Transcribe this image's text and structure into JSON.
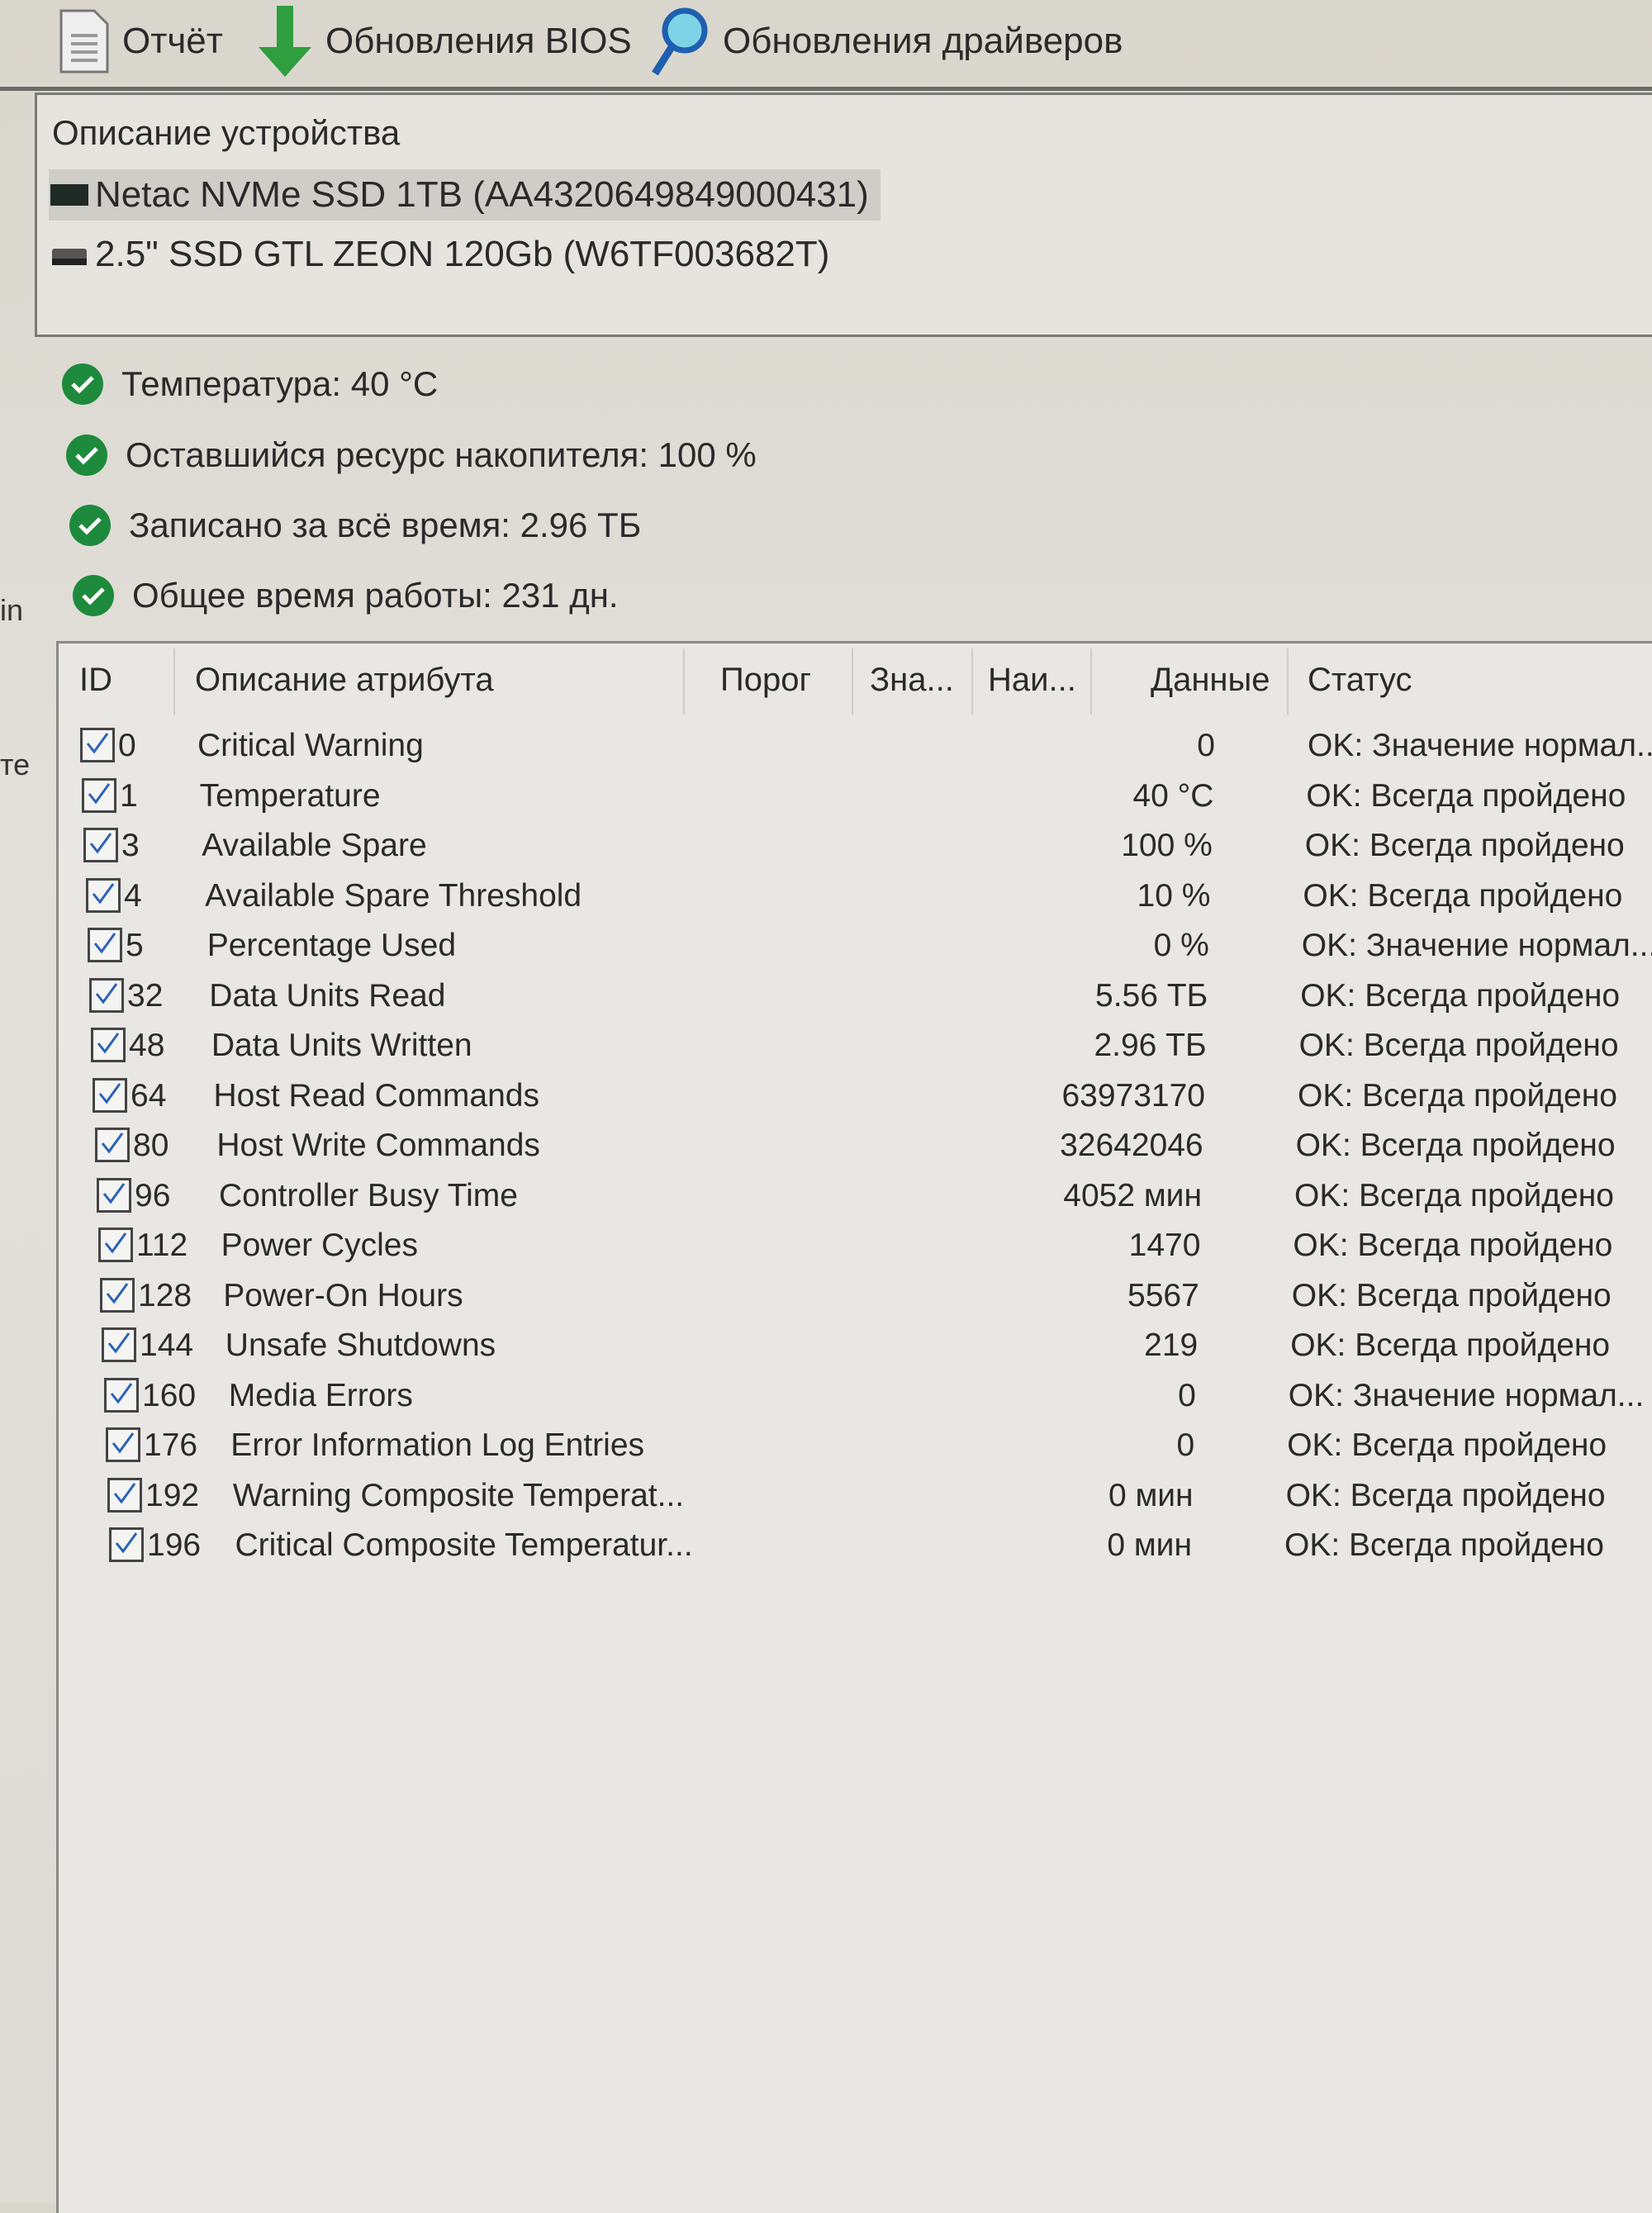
{
  "toolbar": {
    "report": "Отчёт",
    "bios": "Обновления BIOS",
    "drivers": "Обновления драйверов"
  },
  "devices": {
    "title": "Описание устройства",
    "items": [
      {
        "label": "Netac NVMe SSD 1TB (AA4320649849000431)",
        "icon": "nvme-drive-icon",
        "selected": true
      },
      {
        "label": "2.5\" SSD GTL ZEON 120Gb (W6TF003682T)",
        "icon": "sata-drive-icon",
        "selected": false
      }
    ]
  },
  "summary": [
    "Температура: 40 °C",
    "Оставшийся ресурс накопителя: 100 %",
    "Записано за всё время: 2.96 ТБ",
    "Общее время работы: 231 дн."
  ],
  "side_fragments": [
    "in",
    "те"
  ],
  "colors": {
    "ok": "#1e8a3c",
    "bios_arrow": "#2e9e3e",
    "magnifier": "#1e5fb0"
  },
  "table": {
    "headers": {
      "id": "ID",
      "desc": "Описание атрибута",
      "threshold": "Порог",
      "value": "Зна...",
      "worst": "Наи...",
      "data": "Данные",
      "status": "Статус"
    },
    "rows": [
      {
        "id": "0",
        "desc": "Critical Warning",
        "data": "0",
        "status": "OK: Значение нормал..."
      },
      {
        "id": "1",
        "desc": "Temperature",
        "data": "40 °C",
        "status": "OK: Всегда пройдено"
      },
      {
        "id": "3",
        "desc": "Available Spare",
        "data": "100 %",
        "status": "OK: Всегда пройдено"
      },
      {
        "id": "4",
        "desc": "Available Spare Threshold",
        "data": "10 %",
        "status": "OK: Всегда пройдено"
      },
      {
        "id": "5",
        "desc": "Percentage Used",
        "data": "0 %",
        "status": "OK: Значение нормал..."
      },
      {
        "id": "32",
        "desc": "Data Units Read",
        "data": "5.56 ТБ",
        "status": "OK: Всегда пройдено"
      },
      {
        "id": "48",
        "desc": "Data Units Written",
        "data": "2.96 ТБ",
        "status": "OK: Всегда пройдено"
      },
      {
        "id": "64",
        "desc": "Host Read Commands",
        "data": "63973170",
        "status": "OK: Всегда пройдено"
      },
      {
        "id": "80",
        "desc": "Host Write Commands",
        "data": "32642046",
        "status": "OK: Всегда пройдено"
      },
      {
        "id": "96",
        "desc": "Controller Busy Time",
        "data": "4052 мин",
        "status": "OK: Всегда пройдено"
      },
      {
        "id": "112",
        "desc": "Power Cycles",
        "data": "1470",
        "status": "OK: Всегда пройдено"
      },
      {
        "id": "128",
        "desc": "Power-On Hours",
        "data": "5567",
        "status": "OK: Всегда пройдено"
      },
      {
        "id": "144",
        "desc": "Unsafe Shutdowns",
        "data": "219",
        "status": "OK: Всегда пройдено"
      },
      {
        "id": "160",
        "desc": "Media Errors",
        "data": "0",
        "status": "OK: Значение нормал..."
      },
      {
        "id": "176",
        "desc": "Error Information Log Entries",
        "data": "0",
        "status": "OK: Всегда пройдено"
      },
      {
        "id": "192",
        "desc": "Warning Composite Temperat...",
        "data": "0 мин",
        "status": "OK: Всегда пройдено"
      },
      {
        "id": "196",
        "desc": "Critical Composite Temperatur...",
        "data": "0 мин",
        "status": "OK: Всегда пройдено"
      }
    ]
  }
}
